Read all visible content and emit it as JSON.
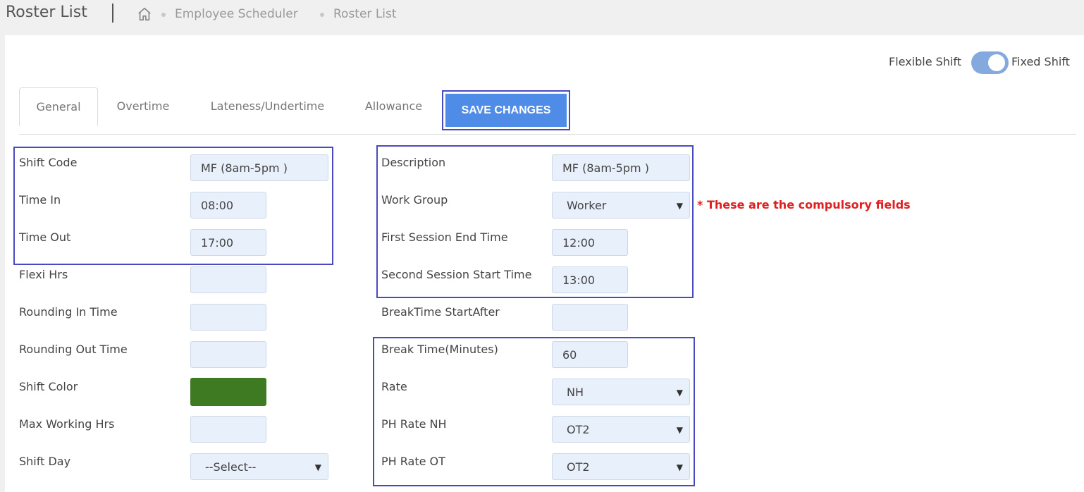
{
  "header": {
    "title": "Roster List",
    "breadcrumb": [
      "Employee Scheduler",
      "Roster List"
    ]
  },
  "toggle": {
    "left_label": "Flexible Shift",
    "right_label": "Fixed Shift",
    "state": "Fixed Shift"
  },
  "tabs": [
    "General",
    "Overtime",
    "Lateness/Undertime",
    "Allowance"
  ],
  "save_label": "SAVE CHANGES",
  "note": "* These are the compulsory fields",
  "left_fields": [
    {
      "label": "Shift Code",
      "value": "MF (8am-5pm )"
    },
    {
      "label": "Time In",
      "value": "08:00"
    },
    {
      "label": "Time Out",
      "value": "17:00"
    },
    {
      "label": "Flexi Hrs",
      "value": ""
    },
    {
      "label": "Rounding In Time",
      "value": ""
    },
    {
      "label": "Rounding Out Time",
      "value": ""
    },
    {
      "label": "Shift Color",
      "value": ""
    },
    {
      "label": "Max Working Hrs",
      "value": ""
    },
    {
      "label": "Shift Day",
      "value": "--Select--"
    }
  ],
  "right_fields": [
    {
      "label": "Description",
      "value": "MF (8am-5pm )"
    },
    {
      "label": "Work Group",
      "value": "Worker"
    },
    {
      "label": "First Session End Time",
      "value": "12:00"
    },
    {
      "label": "Second Session Start Time",
      "value": "13:00"
    },
    {
      "label": "BreakTime StartAfter",
      "value": ""
    },
    {
      "label": "Break Time(Minutes)",
      "value": "60"
    },
    {
      "label": "Rate",
      "value": "NH"
    },
    {
      "label": "PH Rate NH",
      "value": "OT2"
    },
    {
      "label": "PH Rate OT",
      "value": "OT2"
    }
  ],
  "colors": {
    "accent": "#4f8ce8",
    "highlight_border": "#4a4ac0",
    "shift_color": "#3d7a22",
    "note": "#e02020"
  }
}
